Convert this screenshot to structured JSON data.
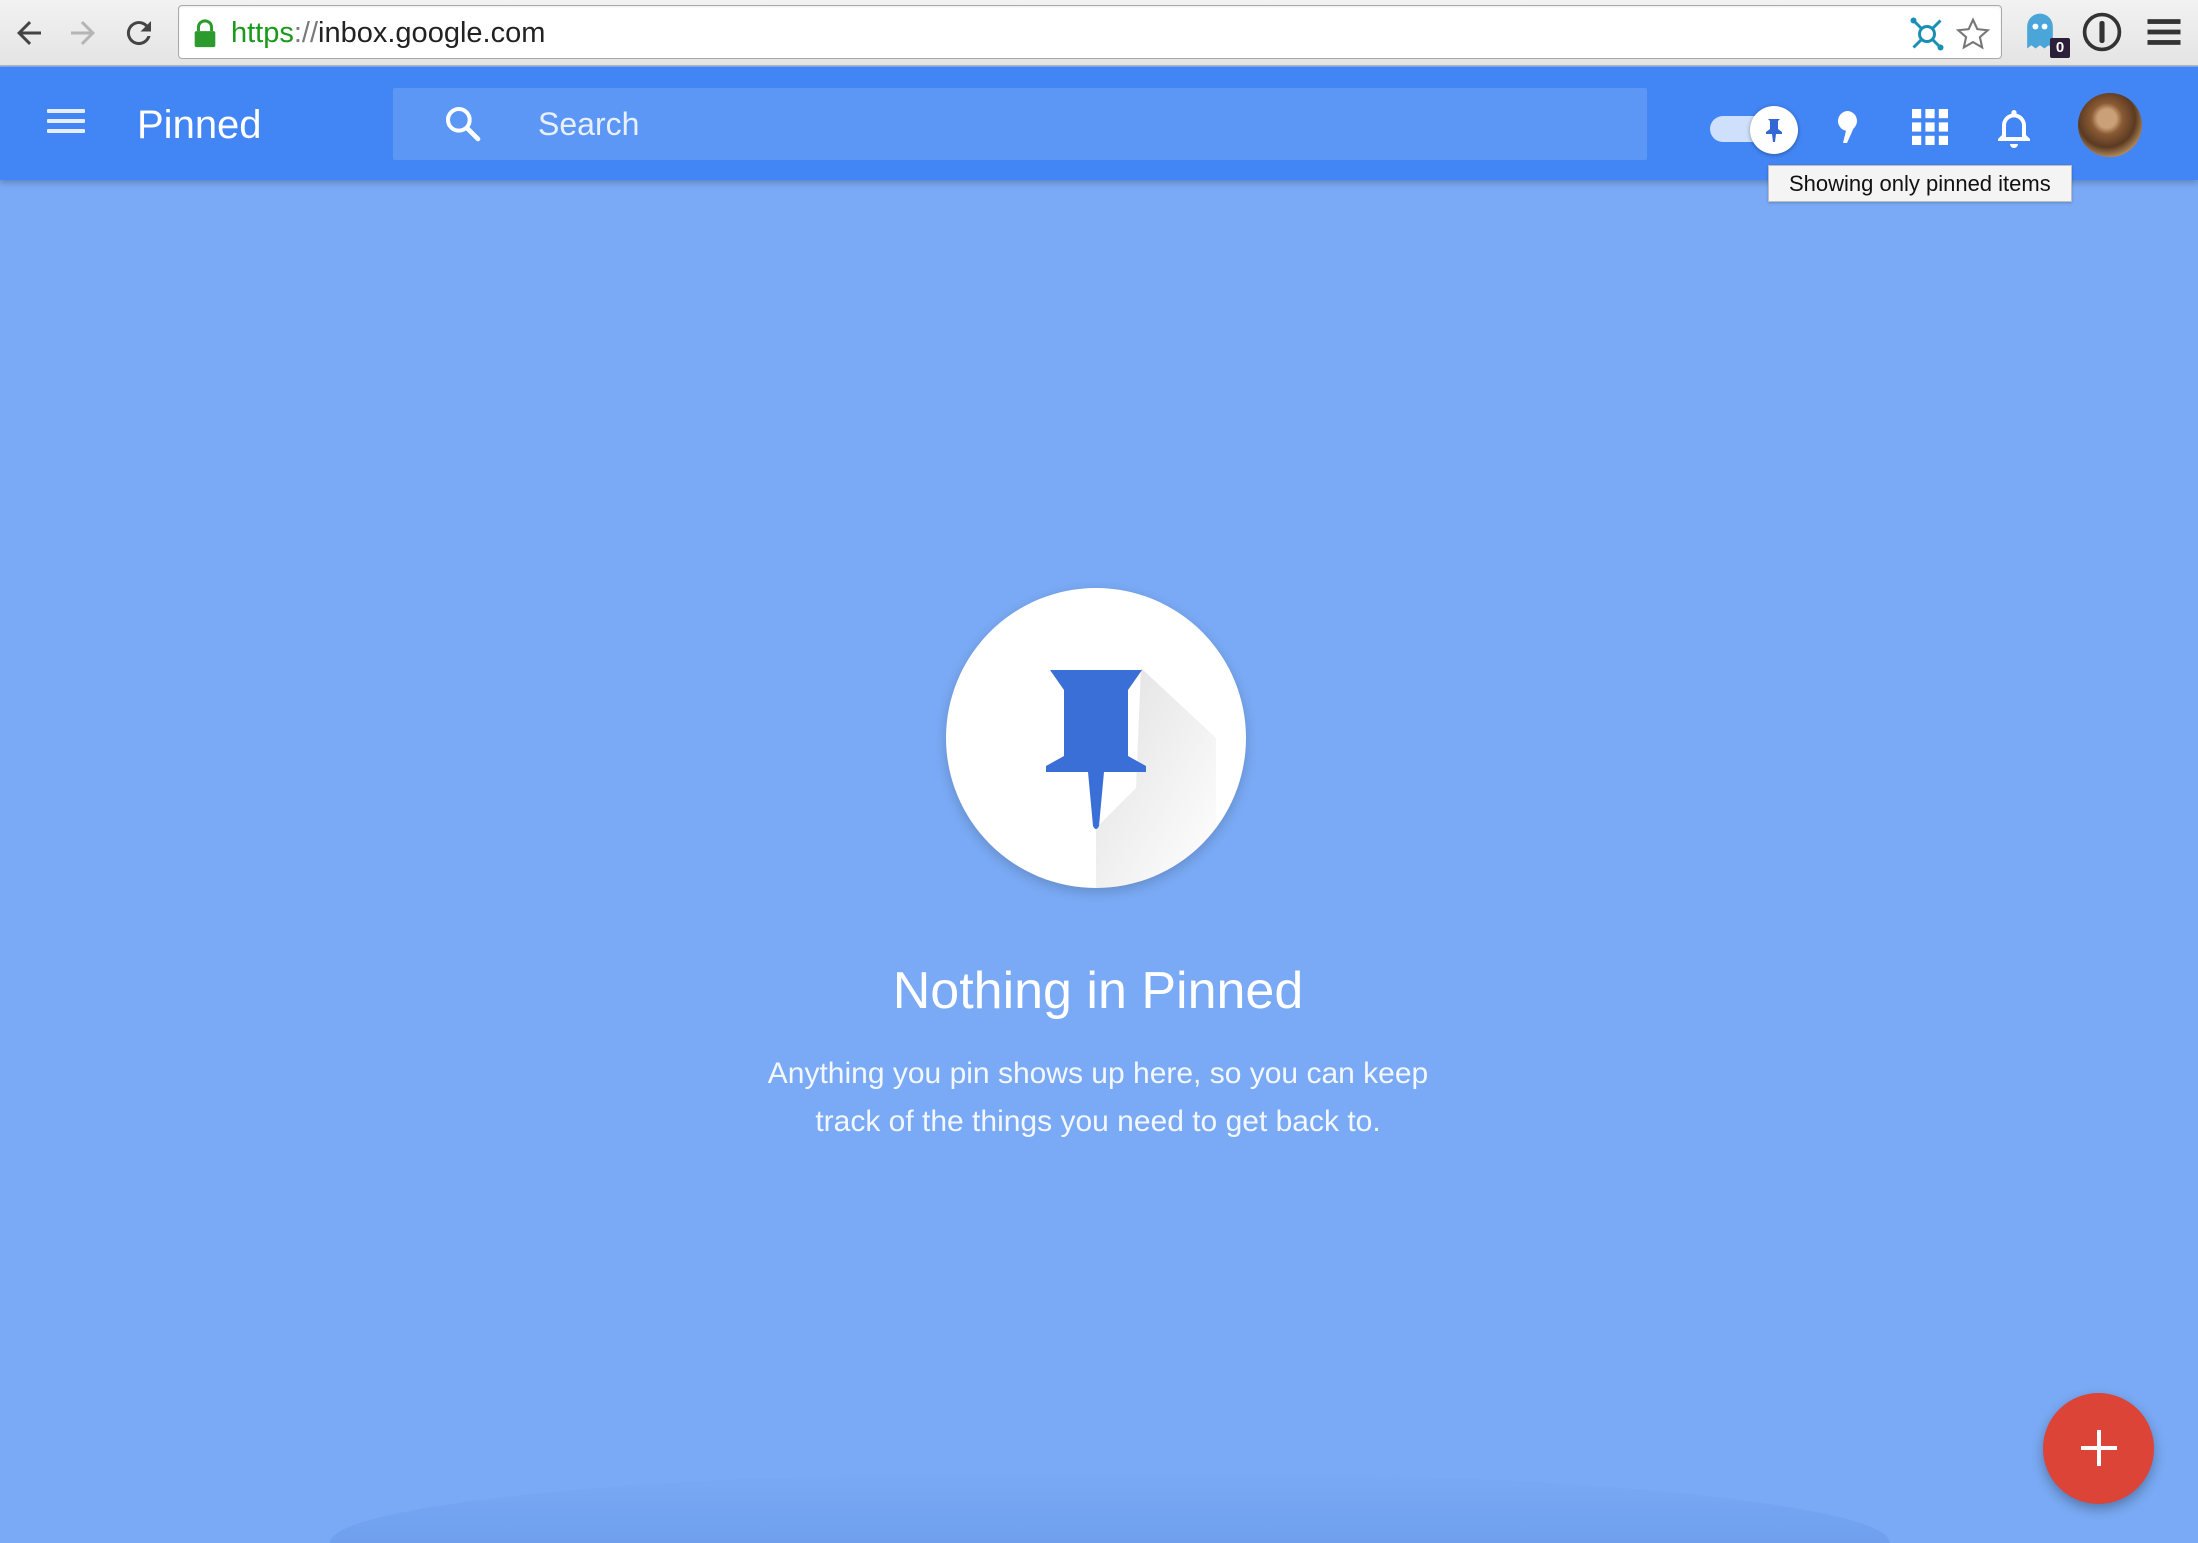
{
  "browser": {
    "url_scheme": "https",
    "url_separator": "://",
    "url_host": "inbox.google.com",
    "icons": {
      "back": "back-arrow-icon",
      "forward": "forward-arrow-icon",
      "reload": "reload-icon",
      "secure": "lock-icon",
      "extension": "extension-network-icon",
      "bookmark": "star-icon",
      "ghostery": "ghost-icon",
      "password": "password-manager-icon",
      "menu": "browser-menu-icon"
    },
    "ghost_badge": "0"
  },
  "appbar": {
    "title": "Pinned",
    "search_placeholder": "Search",
    "tooltip": "Showing only pinned items",
    "colors": {
      "bar": "#4285f4",
      "search": "#5c97f6"
    }
  },
  "empty_state": {
    "title": "Nothing in Pinned",
    "line1": "Anything you pin shows up here, so you can keep",
    "line2": "track of the things you need to get back to.",
    "colors": {
      "background": "#7aaaf5",
      "pin": "#3367d6"
    }
  },
  "fab": {
    "color": "#db4437",
    "icon": "plus-icon"
  }
}
